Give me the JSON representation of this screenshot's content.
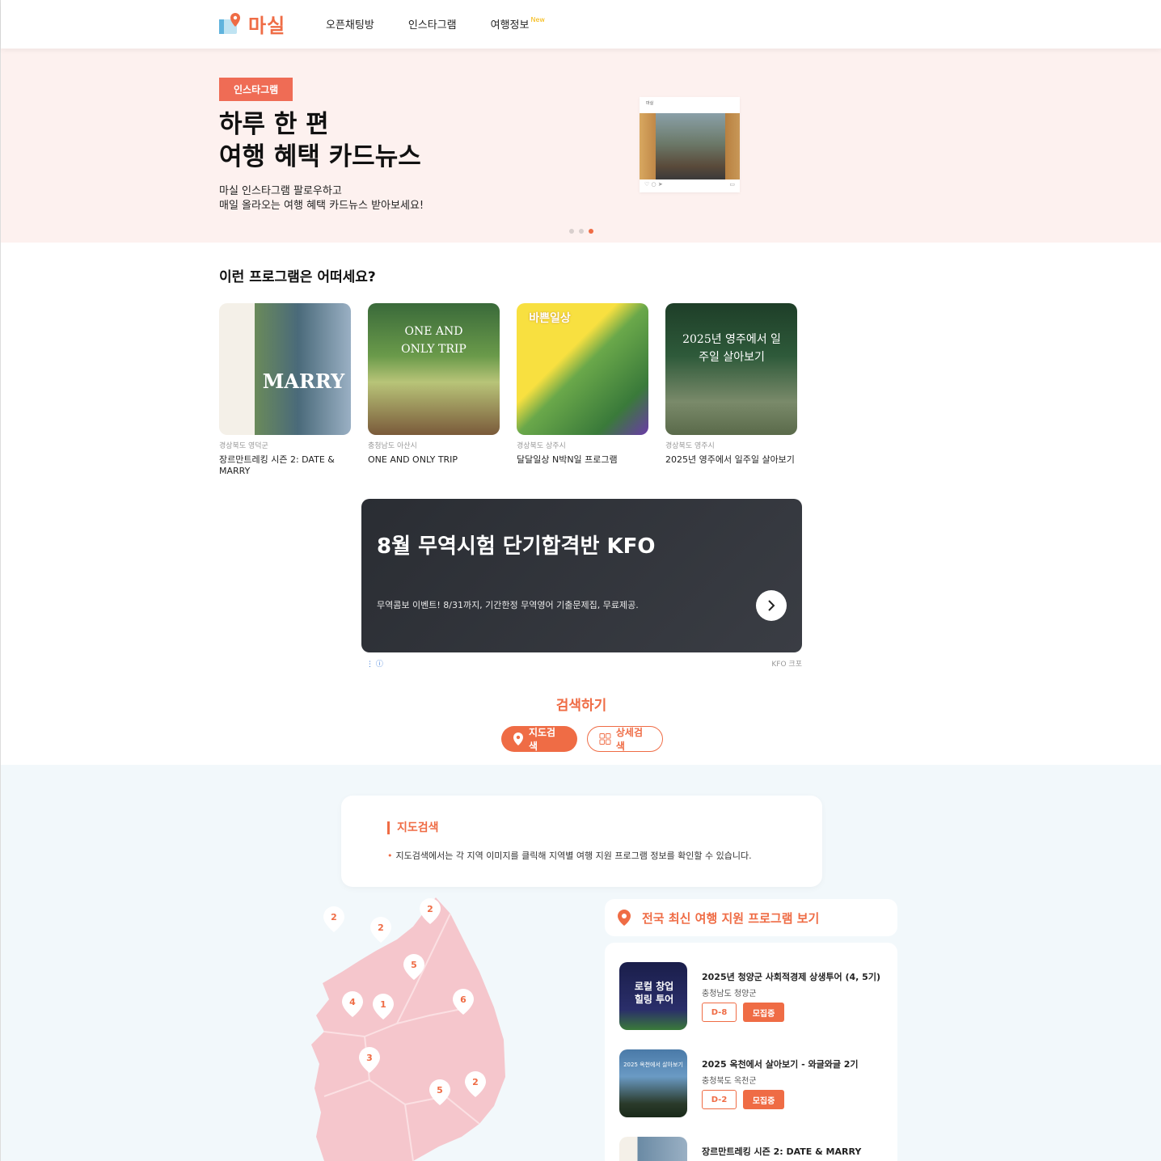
{
  "header": {
    "logo_text": "마실",
    "nav": [
      {
        "label": "오픈채팅방"
      },
      {
        "label": "인스타그램"
      },
      {
        "label": "여행정보",
        "badge": "New"
      }
    ]
  },
  "hero": {
    "tag": "인스타그램",
    "title": "하루 한 편\n여행 혜택 카드뉴스",
    "subtitle": "마실 인스타그램 팔로우하고\n매일 올라오는 여행 혜택 카드뉴스 받아보세요!",
    "card_header": "마실",
    "slides_total": 3,
    "slide_active": 3
  },
  "programs": {
    "title": "이런 프로그램은 어떠세요?",
    "items": [
      {
        "region": "경상북도 영덕군",
        "name": "장르만트레킹 시즌 2: DATE & MARRY",
        "image_text": "MARRY"
      },
      {
        "region": "충청남도 아산시",
        "name": "ONE AND ONLY TRIP",
        "image_text": "ONE AND ONLY TRIP"
      },
      {
        "region": "경상북도 상주시",
        "name": "달달일상 N박N일 프로그램",
        "image_text": "바쁜일상"
      },
      {
        "region": "경상북도 영주시",
        "name": "2025년 영주에서 일주일 살아보기",
        "image_text": "2025년 영주에서 일주일 살아보기"
      }
    ]
  },
  "ad": {
    "title": "8월 무역시험 단기합격반 KFO",
    "description": "무역콤보 이벤트! 8/31까지, 기간한정 무역영어 기출문제집, 무료제공.",
    "brand": "KFO 크포"
  },
  "search": {
    "title": "검색하기",
    "tab_map": "지도검색",
    "tab_detail": "상세검색"
  },
  "map_info": {
    "title": "지도검색",
    "text": "지도검색에서는 각 지역 이미지를 클릭해 지역별 여행 지원 프로그램 정보를 확인할 수 있습니다."
  },
  "map_pins": [
    "2",
    "2",
    "2",
    "5",
    "4",
    "1",
    "6",
    "3",
    "5",
    "2"
  ],
  "latest": {
    "title": "전국 최신 여행 지원 프로그램 보기",
    "items": [
      {
        "title": "2025년 청양군 사회적경제 상생투어 (4, 5기)",
        "region": "충청남도 청양군",
        "dday": "D-8",
        "status": "모집중",
        "image_text": "로컬 창업 힐링 투어"
      },
      {
        "title": "2025 옥천에서 살아보기 - 와글와글 2기",
        "region": "충청북도 옥천군",
        "dday": "D-2",
        "status": "모집중",
        "image_text": "2025 옥천에서 살아보기"
      },
      {
        "title": "장르만트레킹 시즌 2: DATE & MARRY",
        "region": "",
        "dday": "",
        "status": "",
        "image_text": ""
      }
    ]
  },
  "colors": {
    "accent": "#ef6c45",
    "hero_bg": "#fdf1ef",
    "map_bg": "#f2f8fb",
    "map_fill": "#f5c6cc"
  }
}
